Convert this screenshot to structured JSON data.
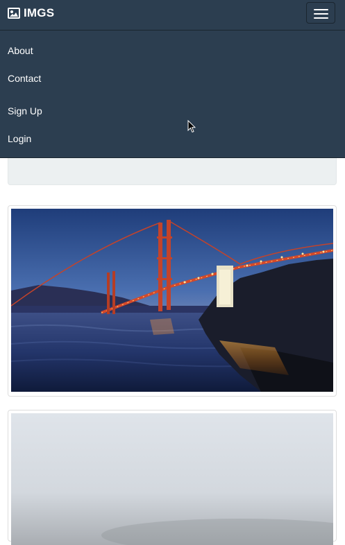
{
  "navbar": {
    "brand": "IMGS",
    "brand_icon": "image-icon",
    "toggle_icon": "hamburger-menu-icon",
    "links": [
      {
        "label": "About"
      },
      {
        "label": "Contact"
      },
      {
        "label": "Sign Up"
      },
      {
        "label": "Login"
      }
    ]
  },
  "colors": {
    "navbar_bg": "#2c3e50",
    "well_bg": "#ecf0f1",
    "text": "#ffffff"
  },
  "gallery": {
    "images": [
      {
        "subject": "golden-gate-bridge-at-dusk"
      },
      {
        "subject": "foggy-sky"
      }
    ]
  }
}
